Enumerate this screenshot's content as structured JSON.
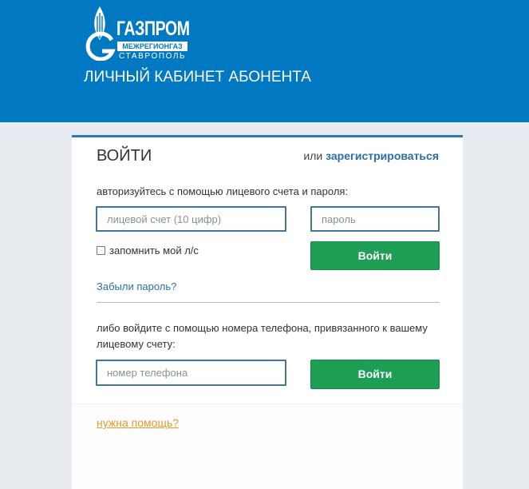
{
  "header": {
    "logo_name": "ГАЗПРОМ",
    "logo_sub": "МЕЖРЕГИОНГАЗ",
    "logo_city": "СТАВРОПОЛЬ",
    "logo_icon": "gazprom-flame-icon",
    "title": "ЛИЧНЫЙ КАБИНЕТ АБОНЕНТА"
  },
  "login": {
    "title": "ВОЙТИ",
    "or": "или",
    "register": "зарегистрироваться",
    "account_hint": "авторизуйтесь с помощью лицевого счета и пароля:",
    "account_placeholder": "лицевой счет (10 цифр)",
    "account_value": "",
    "password_placeholder": "пароль",
    "password_value": "",
    "remember_label": "запомнить мой л/с",
    "remember_checked": false,
    "submit_label": "Войти",
    "forgot": "Забыли пароль?",
    "phone_hint": "либо войдите с помощью номера телефона, привязанного к вашему лицевому счету:",
    "phone_placeholder": "номер телефона",
    "phone_value": "",
    "phone_submit_label": "Войти"
  },
  "footer": {
    "help": "нужна помощь?"
  },
  "colors": {
    "header_bg": "#0079c2",
    "page_bg": "#e8ecf0",
    "link": "#2b6fa8",
    "button": "#1e9d55",
    "help_link": "#e39a2a"
  }
}
